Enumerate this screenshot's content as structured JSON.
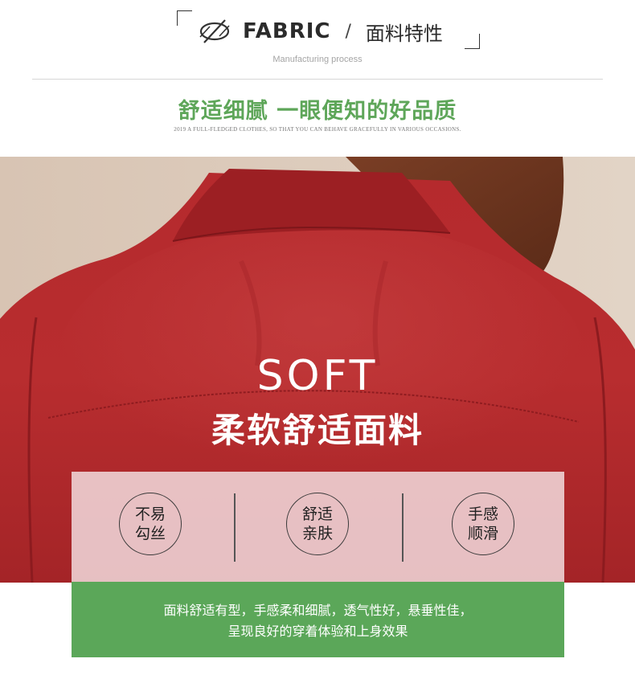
{
  "header": {
    "icon": "no-tear-fabric-icon",
    "title_en": "FABRIC",
    "separator": "/",
    "title_cn": "面料特性",
    "subtitle": "Manufacturing process",
    "headline": "舒适细腻 一眼便知的好品质",
    "tagline": "2019 A FULL-FLEDGED CLOTHES, SO THAT YOU CAN BEHAVE GRACEFULLY IN VARIOUS OCCASIONS."
  },
  "hero": {
    "title_en": "SOFT",
    "title_cn": "柔软舒适面料"
  },
  "features": [
    {
      "line1": "不易",
      "line2": "勾丝"
    },
    {
      "line1": "舒适",
      "line2": "亲肤"
    },
    {
      "line1": "手感",
      "line2": "顺滑"
    }
  ],
  "description": {
    "line1": "面料舒适有型，手感柔和细腻，透气性好，悬垂性佳，",
    "line2": "呈现良好的穿着体验和上身效果"
  },
  "colors": {
    "accent_green": "#5ba759",
    "shirt_red": "#b62a2c",
    "panel_pink": "#f2dcde"
  }
}
